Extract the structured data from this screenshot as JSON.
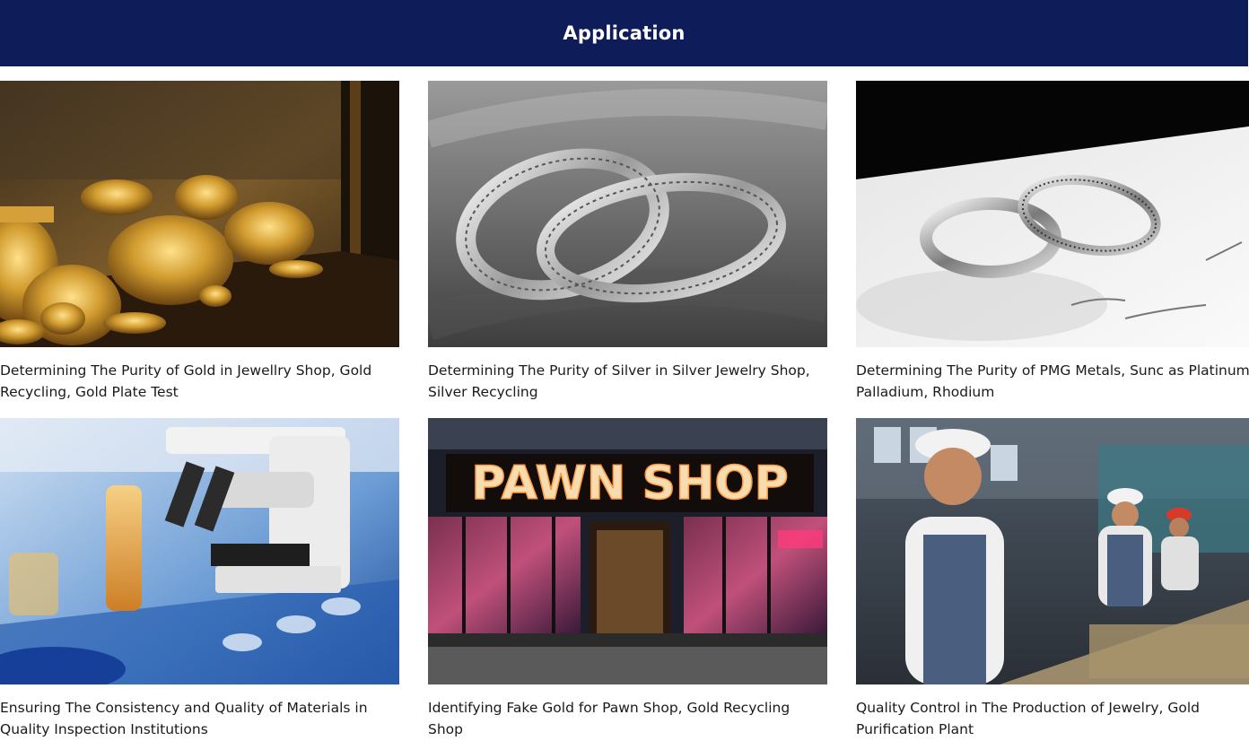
{
  "header": {
    "title": "Application"
  },
  "cards": [
    {
      "caption_line1": "Determining The Purity of Gold in Jewellry Shop, Gold",
      "caption_line2": "Recycling, Gold Plate Test",
      "image": "gold-jewelry-display"
    },
    {
      "caption_line1": "Determining The Purity of Silver in Silver Jewelry Shop,",
      "caption_line2": "Silver Recycling",
      "image": "silver-bracelets"
    },
    {
      "caption_line1": "Determining The Purity of PMG Metals, Sunc as Platinum,",
      "caption_line2": "Palladium, Rhodium",
      "image": "platinum-rings"
    },
    {
      "caption_line1": "Ensuring The Consistency and Quality of Materials in",
      "caption_line2": "Quality Inspection Institutions",
      "image": "lab-microscope"
    },
    {
      "caption_line1": "Identifying Fake Gold for Pawn Shop, Gold Recycling",
      "caption_line2": "Shop",
      "image": "pawn-shop-storefront",
      "sign_text": "PAWN SHOP"
    },
    {
      "caption_line1": "Quality Control in The Production of Jewelry, Gold",
      "caption_line2": "Purification Plant",
      "image": "factory-workers"
    }
  ]
}
